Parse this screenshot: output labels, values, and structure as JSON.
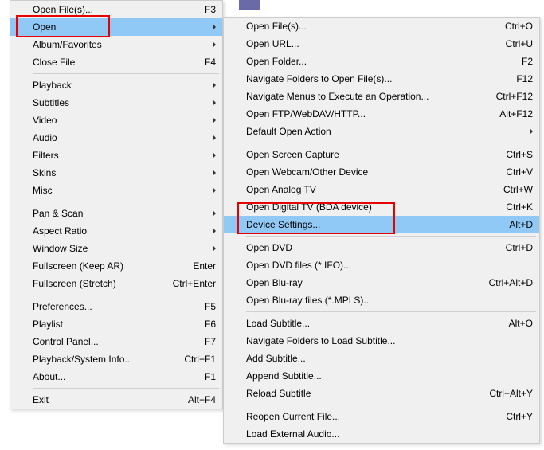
{
  "left_menu": [
    {
      "t": "item",
      "label": "Open File(s)...",
      "shortcut": "F3",
      "submenu": false
    },
    {
      "t": "item",
      "label": "Open",
      "shortcut": "",
      "submenu": true,
      "selected": true
    },
    {
      "t": "item",
      "label": "Album/Favorites",
      "shortcut": "",
      "submenu": true
    },
    {
      "t": "item",
      "label": "Close File",
      "shortcut": "F4",
      "submenu": false
    },
    {
      "t": "sep"
    },
    {
      "t": "item",
      "label": "Playback",
      "shortcut": "",
      "submenu": true
    },
    {
      "t": "item",
      "label": "Subtitles",
      "shortcut": "",
      "submenu": true
    },
    {
      "t": "item",
      "label": "Video",
      "shortcut": "",
      "submenu": true
    },
    {
      "t": "item",
      "label": "Audio",
      "shortcut": "",
      "submenu": true
    },
    {
      "t": "item",
      "label": "Filters",
      "shortcut": "",
      "submenu": true
    },
    {
      "t": "item",
      "label": "Skins",
      "shortcut": "",
      "submenu": true
    },
    {
      "t": "item",
      "label": "Misc",
      "shortcut": "",
      "submenu": true
    },
    {
      "t": "sep"
    },
    {
      "t": "item",
      "label": "Pan & Scan",
      "shortcut": "",
      "submenu": true
    },
    {
      "t": "item",
      "label": "Aspect Ratio",
      "shortcut": "",
      "submenu": true
    },
    {
      "t": "item",
      "label": "Window Size",
      "shortcut": "",
      "submenu": true
    },
    {
      "t": "item",
      "label": "Fullscreen (Keep AR)",
      "shortcut": "Enter",
      "submenu": false
    },
    {
      "t": "item",
      "label": "Fullscreen (Stretch)",
      "shortcut": "Ctrl+Enter",
      "submenu": false
    },
    {
      "t": "sep"
    },
    {
      "t": "item",
      "label": "Preferences...",
      "shortcut": "F5",
      "submenu": false
    },
    {
      "t": "item",
      "label": "Playlist",
      "shortcut": "F6",
      "submenu": false
    },
    {
      "t": "item",
      "label": "Control Panel...",
      "shortcut": "F7",
      "submenu": false
    },
    {
      "t": "item",
      "label": "Playback/System Info...",
      "shortcut": "Ctrl+F1",
      "submenu": false
    },
    {
      "t": "item",
      "label": "About...",
      "shortcut": "F1",
      "submenu": false
    },
    {
      "t": "sep"
    },
    {
      "t": "item",
      "label": "Exit",
      "shortcut": "Alt+F4",
      "submenu": false
    }
  ],
  "right_menu": [
    {
      "t": "item",
      "label": "Open File(s)...",
      "shortcut": "Ctrl+O",
      "submenu": false
    },
    {
      "t": "item",
      "label": "Open URL...",
      "shortcut": "Ctrl+U",
      "submenu": false
    },
    {
      "t": "item",
      "label": "Open Folder...",
      "shortcut": "F2",
      "submenu": false
    },
    {
      "t": "item",
      "label": "Navigate Folders to Open File(s)...",
      "shortcut": "F12",
      "submenu": false
    },
    {
      "t": "item",
      "label": "Navigate Menus to Execute an Operation...",
      "shortcut": "Ctrl+F12",
      "submenu": false
    },
    {
      "t": "item",
      "label": "Open FTP/WebDAV/HTTP...",
      "shortcut": "Alt+F12",
      "submenu": false
    },
    {
      "t": "item",
      "label": "Default Open Action",
      "shortcut": "",
      "submenu": true
    },
    {
      "t": "sep"
    },
    {
      "t": "item",
      "label": "Open Screen Capture",
      "shortcut": "Ctrl+S",
      "submenu": false
    },
    {
      "t": "item",
      "label": "Open Webcam/Other Device",
      "shortcut": "Ctrl+V",
      "submenu": false
    },
    {
      "t": "item",
      "label": "Open Analog TV",
      "shortcut": "Ctrl+W",
      "submenu": false
    },
    {
      "t": "item",
      "label": "Open Digital TV (BDA device)",
      "shortcut": "Ctrl+K",
      "submenu": false
    },
    {
      "t": "item",
      "label": "Device Settings...",
      "shortcut": "Alt+D",
      "submenu": false,
      "selected": true
    },
    {
      "t": "sep"
    },
    {
      "t": "item",
      "label": "Open DVD",
      "shortcut": "Ctrl+D",
      "submenu": false
    },
    {
      "t": "item",
      "label": "Open DVD files (*.IFO)...",
      "shortcut": "",
      "submenu": false
    },
    {
      "t": "item",
      "label": "Open Blu-ray",
      "shortcut": "Ctrl+Alt+D",
      "submenu": false
    },
    {
      "t": "item",
      "label": "Open Blu-ray files (*.MPLS)...",
      "shortcut": "",
      "submenu": false
    },
    {
      "t": "sep"
    },
    {
      "t": "item",
      "label": "Load Subtitle...",
      "shortcut": "Alt+O",
      "submenu": false
    },
    {
      "t": "item",
      "label": "Navigate Folders to Load Subtitle...",
      "shortcut": "",
      "submenu": false
    },
    {
      "t": "item",
      "label": "Add Subtitle...",
      "shortcut": "",
      "submenu": false
    },
    {
      "t": "item",
      "label": "Append Subtitle...",
      "shortcut": "",
      "submenu": false
    },
    {
      "t": "item",
      "label": "Reload Subtitle",
      "shortcut": "Ctrl+Alt+Y",
      "submenu": false
    },
    {
      "t": "sep"
    },
    {
      "t": "item",
      "label": "Reopen Current File...",
      "shortcut": "Ctrl+Y",
      "submenu": false
    },
    {
      "t": "item",
      "label": "Load External Audio...",
      "shortcut": "",
      "submenu": false
    }
  ]
}
